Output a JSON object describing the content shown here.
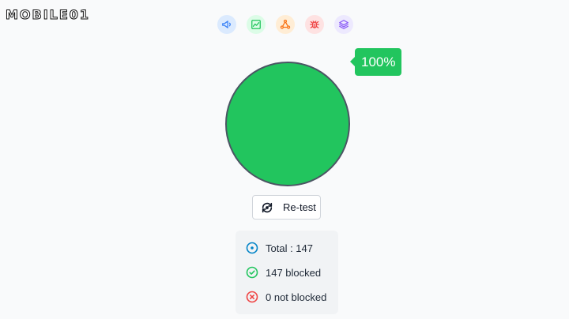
{
  "watermark": {
    "text": "MOBILE01"
  },
  "toolbar": {
    "icons": [
      {
        "name": "megaphone-icon",
        "color": "#3b82f6"
      },
      {
        "name": "chart-icon",
        "color": "#22c55e"
      },
      {
        "name": "network-icon",
        "color": "#f97316"
      },
      {
        "name": "bug-icon",
        "color": "#ef4444"
      },
      {
        "name": "layers-icon",
        "color": "#8b5cf6"
      }
    ]
  },
  "result": {
    "percent_label": "100%",
    "percent_value": 100,
    "status_color": "#22c55e"
  },
  "retest": {
    "label": "Re-test"
  },
  "summary": {
    "total": "Total : 147",
    "blocked": "147 blocked",
    "not_blocked": "0 not blocked",
    "colors": {
      "total": "#0284c7",
      "blocked": "#22c55e",
      "not_blocked": "#ef4444"
    }
  }
}
